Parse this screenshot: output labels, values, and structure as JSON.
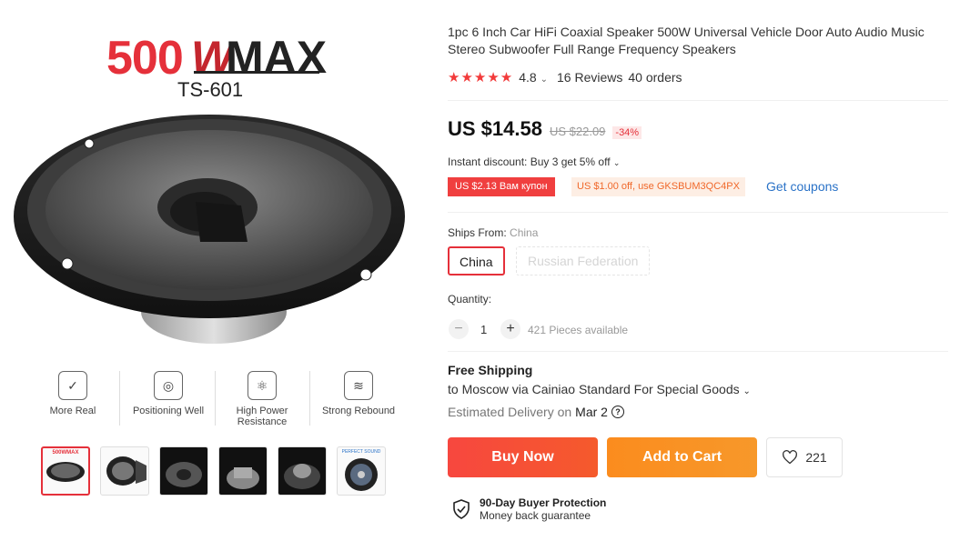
{
  "product": {
    "title": "1pc 6 Inch Car HiFi Coaxial Speaker 500W Universal Vehicle Door Auto Audio Music Stereo Subwoofer Full Range Frequency Speakers",
    "rating": "4.8",
    "rating_chevron": "⌄",
    "stars": "★★★★★",
    "reviews": "16 Reviews",
    "orders": "40 orders"
  },
  "image": {
    "brand_number": "500",
    "brand_w": "W",
    "brand_max": "MAX",
    "model": "TS-601",
    "features": [
      {
        "label": "More Real",
        "icon": "check-icon"
      },
      {
        "label": "Positioning Well",
        "icon": "target-icon"
      },
      {
        "label": "High Power Resistance",
        "icon": "atom-icon"
      },
      {
        "label": "Strong Rebound",
        "icon": "spring-icon"
      }
    ],
    "thumb_caption_1": "500WMAX",
    "thumb_caption_6": "PERFECT SOUND"
  },
  "price": {
    "current": "US $14.58",
    "original": "US $22.09",
    "discount": "-34%"
  },
  "promotions": {
    "instant": "Instant discount: Buy 3 get 5% off",
    "coupon_store": "US $2.13 Вам купон",
    "coupon_code": "US $1.00 off, use GKSBUM3QC4PX",
    "get_coupons": "Get coupons"
  },
  "shipping": {
    "ships_from_label": "Ships From:",
    "ships_from_value": "China",
    "options": [
      "China",
      "Russian Federation"
    ],
    "free_shipping": "Free Shipping",
    "route": "to Moscow via Cainiao Standard For Special Goods",
    "eta_label": "Estimated Delivery on",
    "eta_date": "Mar 2"
  },
  "quantity": {
    "label": "Quantity:",
    "value": "1",
    "minus": "−",
    "plus": "+",
    "available": "421 Pieces available"
  },
  "actions": {
    "buy_now": "Buy Now",
    "add_to_cart": "Add to Cart",
    "wishlist_count": "221"
  },
  "protection": {
    "title": "90-Day Buyer Protection",
    "subtitle": "Money back guarantee"
  },
  "colors": {
    "accent": "#e5303a",
    "orange": "#fb8c1e",
    "link": "#2a72c7"
  }
}
